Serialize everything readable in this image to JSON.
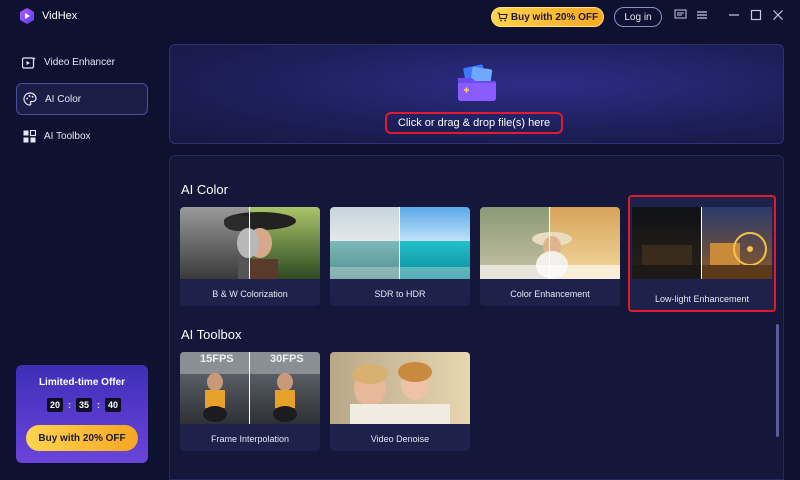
{
  "app": {
    "name": "VidHex"
  },
  "header": {
    "buy_label": "Buy with 20% OFF",
    "login_label": "Log in"
  },
  "sidebar": {
    "items": [
      {
        "label": "Video Enhancer",
        "icon": "video-enhancer-icon"
      },
      {
        "label": "AI Color",
        "icon": "palette-icon",
        "active": true
      },
      {
        "label": "AI Toolbox",
        "icon": "toolbox-icon"
      }
    ]
  },
  "promo": {
    "title": "Limited-time Offer",
    "timer": {
      "hours": "20",
      "minutes": "35",
      "seconds": "40",
      "sep": ":"
    },
    "button_label": "Buy with 20% OFF"
  },
  "dropzone": {
    "text": "Click or drag & drop file(s) here"
  },
  "sections": [
    {
      "title": "AI Color",
      "cards": [
        {
          "label": "B & W Colorization"
        },
        {
          "label": "SDR to HDR"
        },
        {
          "label": "Color Enhancement"
        },
        {
          "label": "Low-light Enhancement",
          "highlighted": true
        }
      ]
    },
    {
      "title": "AI Toolbox",
      "cards": [
        {
          "label": "Frame Interpolation",
          "overlay_left": "15FPS",
          "overlay_right": "30FPS"
        },
        {
          "label": "Video Denoise"
        }
      ]
    }
  ],
  "colors": {
    "accent": "#e21a2b",
    "gold": "#f7a823",
    "background": "#0f1130"
  }
}
